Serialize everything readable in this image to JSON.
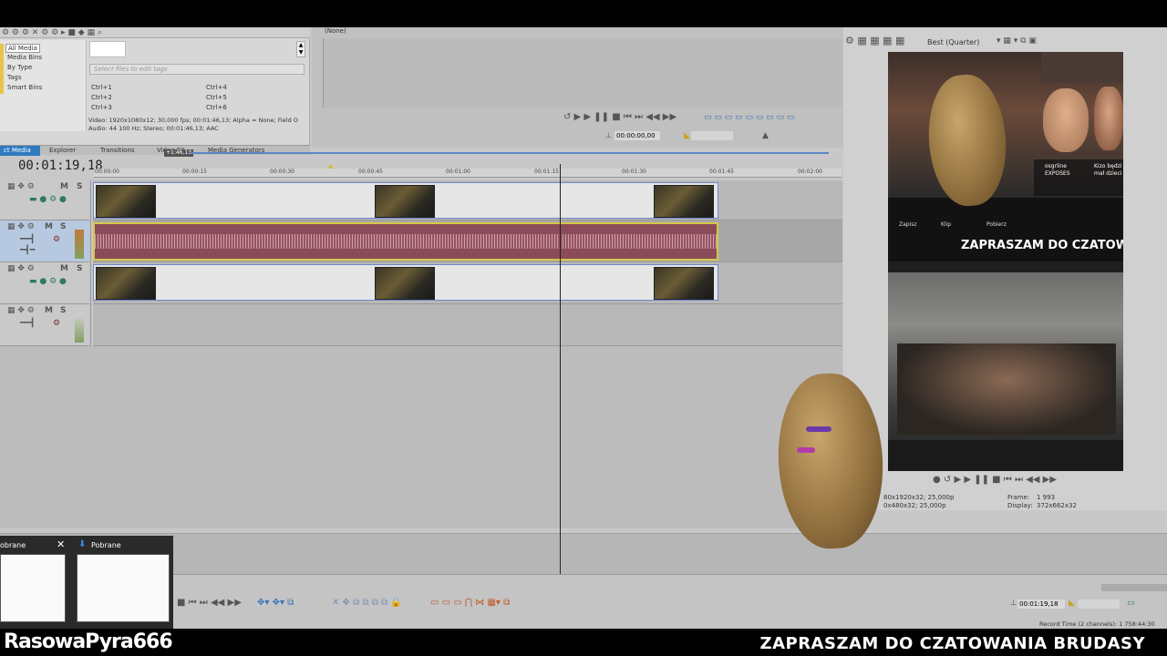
{
  "explorer": {
    "tree": [
      "All Media",
      "Media Bins",
      "By Type",
      "Tags",
      "Smart Bins"
    ],
    "tag_placeholder": "Select files to edit tags",
    "shortcuts": [
      "Ctrl+1",
      "Ctrl+2",
      "Ctrl+3",
      "Ctrl+4",
      "Ctrl+5",
      "Ctrl+6"
    ],
    "media_info_1": "Video: 1920x1080x12; 30,000 fps; 00:01:46,13; Alpha = None; Field O",
    "media_info_2": "Audio: 44 100 Hz; Stereo; 00:01:46,13; AAC",
    "tabs": [
      "ct Media",
      "Explorer",
      "Transitions",
      "Video FX",
      "Media Generators"
    ]
  },
  "trimmer": {
    "title": "(None)",
    "timecode": "00:00:00,00"
  },
  "timeline": {
    "timecode": "00:01:19,18",
    "region_label": "+1:46,13",
    "ruler": [
      "00:00:00",
      "00:00:15",
      "00:00:30",
      "00:00:45",
      "00:01:00",
      "00:01:15",
      "00:01:30",
      "00:01:45",
      "00:02:00"
    ],
    "track_buttons": [
      "M",
      "S"
    ]
  },
  "preview": {
    "quality": "Best (Quarter)",
    "caption": "ZAPRASZAM DO CZATOWAN",
    "yt_line1": "Kizo będzi",
    "yt_line2": "mał dzieci",
    "yt_line3": "osgrline",
    "yt_line4": "EXPOSES",
    "yt_buttons": [
      "Zapisz",
      "Klip",
      "Pobierz"
    ],
    "project_info": "80x1920x32; 25,000p",
    "preview_info": "0x480x32; 25,000p",
    "frame_label": "Frame:",
    "frame_value": "1 993",
    "display_label": "Display:",
    "display_value": "372x662x32"
  },
  "bottom": {
    "timecode": "00:01:19,18",
    "record_time": "Record Time (2 channels): 1 758:44:30"
  },
  "taskbar": {
    "title_left": "obrane",
    "title_right": "Pobrane"
  },
  "overlay": {
    "left": "RasowaPyra666",
    "right": "ZAPRASZAM DO CZATOWANIA BRUDASY"
  }
}
